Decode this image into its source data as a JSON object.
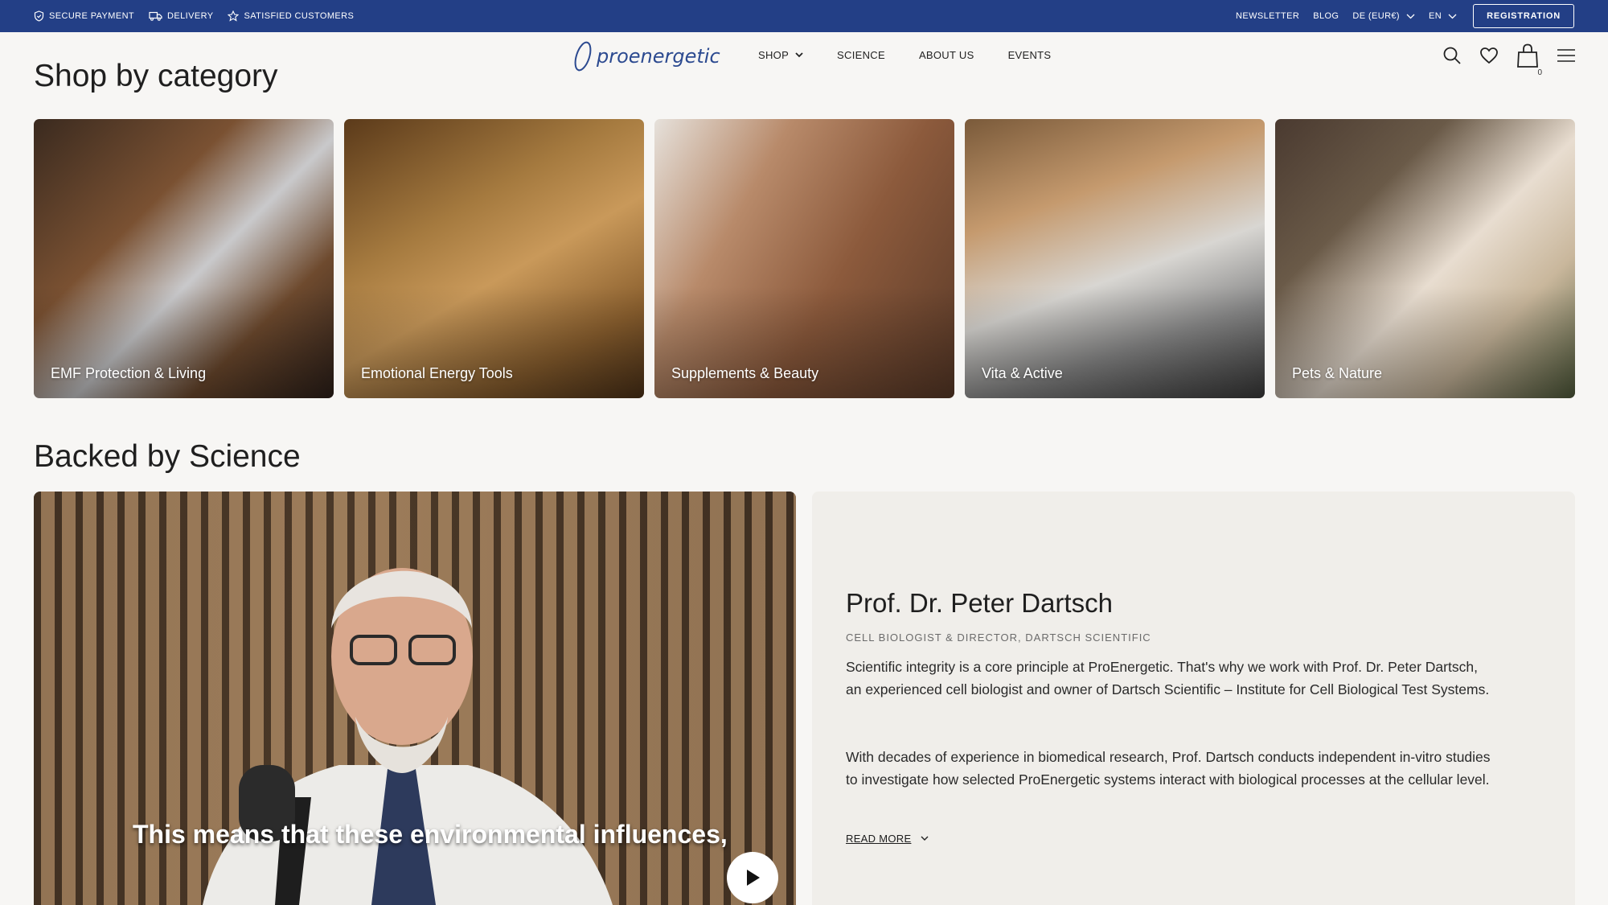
{
  "topbar": {
    "left": [
      {
        "label": "SECURE PAYMENT",
        "icon": "shield-check-icon"
      },
      {
        "label": "DELIVERY",
        "icon": "truck-icon"
      },
      {
        "label": "SATISFIED CUSTOMERS",
        "icon": "star-icon"
      }
    ],
    "newsletter": "NEWSLETTER",
    "blog": "BLOG",
    "country": "DE (EUR€)",
    "language": "EN",
    "registration": "REGISTRATION",
    "color": "#233f86"
  },
  "header": {
    "logo_text": "proenergetic",
    "nav": [
      "SHOP",
      "SCIENCE",
      "ABOUT US",
      "EVENTS"
    ],
    "cart_count": "0"
  },
  "categories": {
    "title": "Shop by category",
    "items": [
      {
        "label": "EMF Protection & Living"
      },
      {
        "label": "Emotional Energy Tools"
      },
      {
        "label": "Supplements & Beauty"
      },
      {
        "label": "Vita & Active"
      },
      {
        "label": "Pets & Nature"
      }
    ]
  },
  "science": {
    "title": "Backed by Science",
    "video_caption": "This means that these environmental influences,",
    "name": "Prof. Dr. Peter Dartsch",
    "role": "CELL BIOLOGIST & DIRECTOR, DARTSCH SCIENTIFIC",
    "p1": "Scientific integrity is a core principle at ProEnergetic. That's why we work with Prof. Dr. Peter Dartsch, an experienced cell biologist and owner of Dartsch Scientific – Institute for Cell Biological Test Systems.",
    "p2": "With decades of experience in biomedical research, Prof. Dartsch conducts independent in-vitro studies to investigate how selected ProEnergetic systems interact with biological processes at the cellular level.",
    "read_more": "READ MORE"
  }
}
